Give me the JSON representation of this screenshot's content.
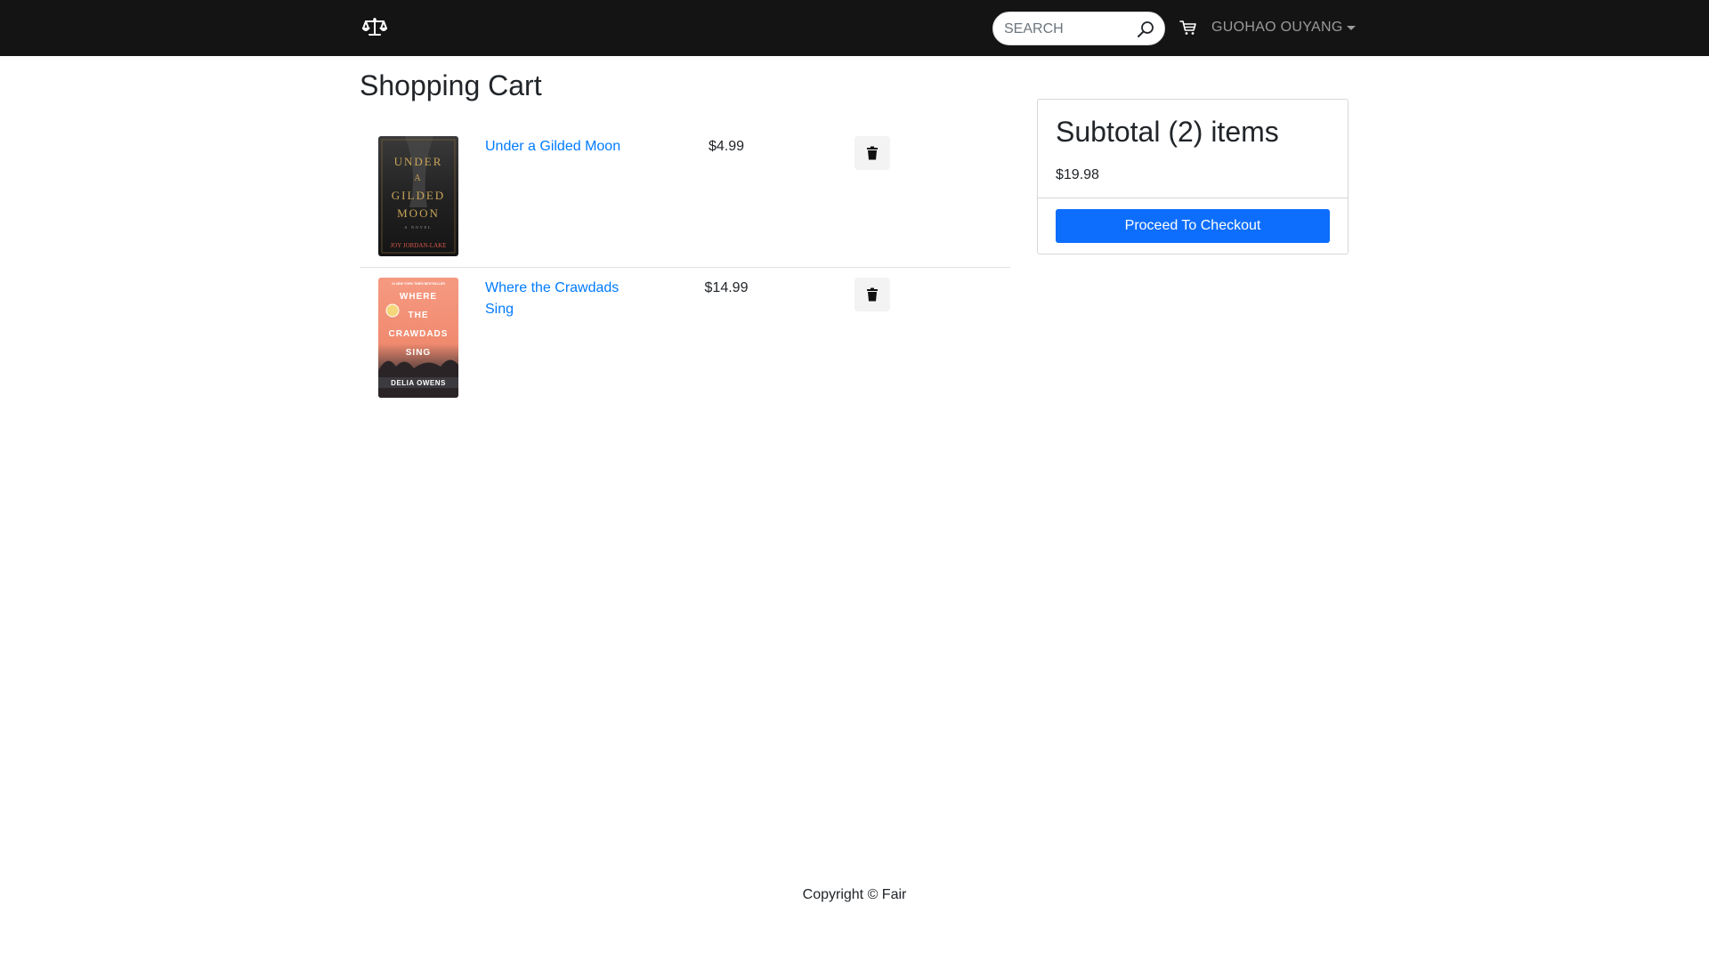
{
  "header": {
    "logo_icon": "scales-icon",
    "search": {
      "placeholder": "SEARCH",
      "value": ""
    },
    "cart_icon": "shopping-cart-icon",
    "user_name": "GUOHAO OUYANG"
  },
  "main": {
    "title": "Shopping Cart",
    "items": [
      {
        "name": "Under a Gilded Moon",
        "price": "$4.99",
        "cover": {
          "lines": [
            "UNDER",
            "A",
            "GILDED",
            "MOON"
          ],
          "subtitle": "A NOVEL",
          "author": "JOY JORDAN-LAKE"
        }
      },
      {
        "name": "Where the Crawdads Sing",
        "price": "$14.99",
        "cover": {
          "banner": "#1 NEW YORK TIMES BESTSELLER",
          "lines": [
            "WHERE",
            "THE",
            "CRAWDADS",
            "SING"
          ],
          "author": "DELIA OWENS"
        }
      }
    ]
  },
  "summary": {
    "title": "Subtotal (2) items",
    "total": "$19.98",
    "checkout_label": "Proceed To Checkout"
  },
  "footer": {
    "copyright": "Copyright © Fair"
  },
  "colors": {
    "navbar": "#141414",
    "link": "#007bff",
    "primary_button": "#0d6efd"
  }
}
